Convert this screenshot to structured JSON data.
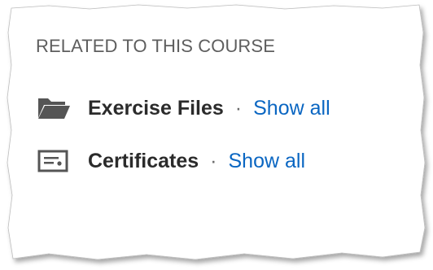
{
  "section": {
    "title": "RELATED TO THIS COURSE"
  },
  "items": [
    {
      "icon": "folder-icon",
      "label": "Exercise Files",
      "separator": "·",
      "link": "Show all"
    },
    {
      "icon": "certificate-icon",
      "label": "Certificates",
      "separator": "·",
      "link": "Show all"
    }
  ],
  "colors": {
    "link": "#0a66c2",
    "heading": "#5e5e5e",
    "label": "#2b2b2b",
    "icon": "#555555"
  }
}
